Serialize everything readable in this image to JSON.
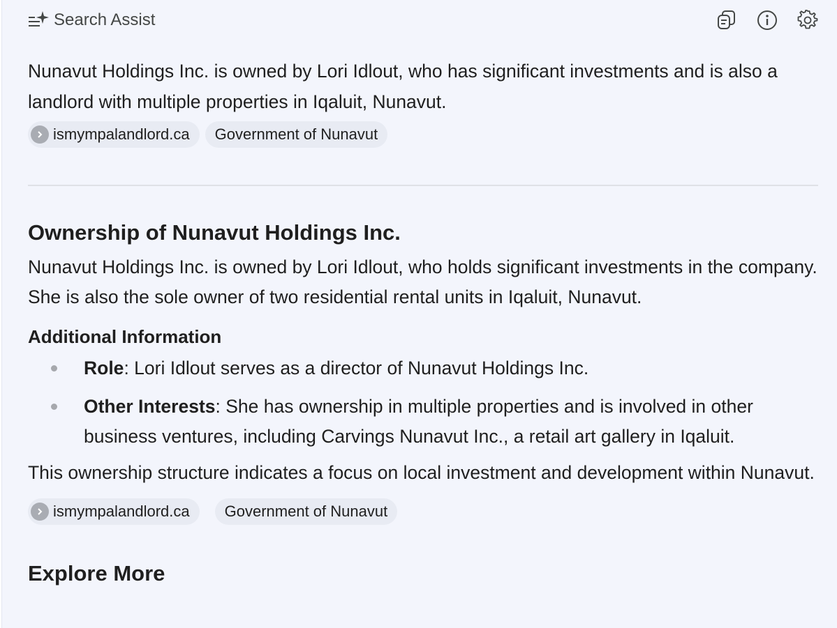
{
  "header": {
    "title": "Search Assist",
    "icons": [
      "sparkle-list-icon",
      "copy-icon",
      "info-icon",
      "gear-icon"
    ]
  },
  "summary": {
    "text": "Nunavut Holdings Inc. is owned by Lori Idlout, who has significant investments and is also a landlord with multiple properties in Iqaluit, Nunavut.",
    "sources": [
      "ismympalandlord.ca",
      "Government of Nunavut"
    ]
  },
  "section": {
    "title": "Ownership of Nunavut Holdings Inc.",
    "paragraph": "Nunavut Holdings Inc. is owned by Lori Idlout, who holds significant investments in the company. She is also the sole owner of two residential rental units in Iqaluit, Nunavut.",
    "subheading": "Additional Information",
    "bullets": [
      {
        "term": "Role",
        "text": ": Lori Idlout serves as a director of Nunavut Holdings Inc."
      },
      {
        "term": "Other Interests",
        "text": ": She has ownership in multiple properties and is involved in other business ventures, including Carvings Nunavut Inc., a retail art gallery in Iqaluit."
      }
    ],
    "closing": "This ownership structure indicates a focus on local investment and development within Nunavut.",
    "sources": [
      "ismympalandlord.ca",
      "Government of Nunavut"
    ]
  },
  "explore": {
    "title": "Explore More"
  },
  "colors": {
    "panel_bg": "#f3f5fc",
    "chip_bg": "#e8ebf3",
    "text": "#1f1f1f",
    "muted": "#444746"
  }
}
